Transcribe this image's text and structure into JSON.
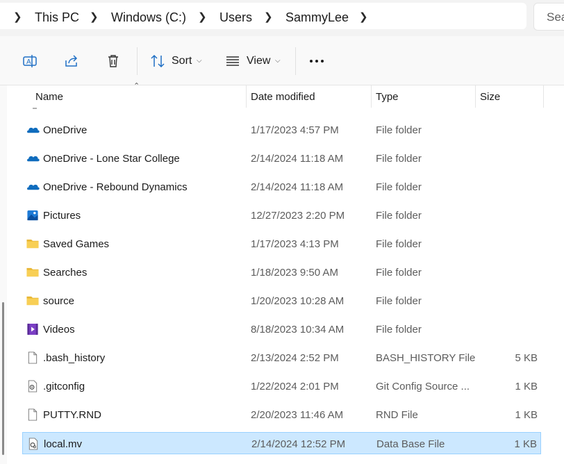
{
  "breadcrumb": {
    "items": [
      "This PC",
      "Windows (C:)",
      "Users",
      "SammyLee"
    ]
  },
  "search": {
    "placeholder": "Sea"
  },
  "toolbar": {
    "sort_label": "Sort",
    "view_label": "View"
  },
  "columns": {
    "name": "Name",
    "date": "Date modified",
    "type": "Type",
    "size": "Size"
  },
  "files": [
    {
      "name": "OneDrive",
      "date": "1/17/2023 4:57 PM",
      "type": "File folder",
      "size": "",
      "icon": "onedrive-icon"
    },
    {
      "name": "OneDrive - Lone Star College",
      "date": "2/14/2024 11:18 AM",
      "type": "File folder",
      "size": "",
      "icon": "onedrive-icon"
    },
    {
      "name": "OneDrive - Rebound Dynamics",
      "date": "2/14/2024 11:18 AM",
      "type": "File folder",
      "size": "",
      "icon": "onedrive-icon"
    },
    {
      "name": "Pictures",
      "date": "12/27/2023 2:20 PM",
      "type": "File folder",
      "size": "",
      "icon": "pictures-icon"
    },
    {
      "name": "Saved Games",
      "date": "1/17/2023 4:13 PM",
      "type": "File folder",
      "size": "",
      "icon": "folder-icon"
    },
    {
      "name": "Searches",
      "date": "1/18/2023 9:50 AM",
      "type": "File folder",
      "size": "",
      "icon": "folder-icon"
    },
    {
      "name": "source",
      "date": "1/20/2023 10:28 AM",
      "type": "File folder",
      "size": "",
      "icon": "folder-icon"
    },
    {
      "name": "Videos",
      "date": "8/18/2023 10:34 AM",
      "type": "File folder",
      "size": "",
      "icon": "videos-icon"
    },
    {
      "name": ".bash_history",
      "date": "2/13/2024 2:52 PM",
      "type": "BASH_HISTORY File",
      "size": "5 KB",
      "icon": "file-icon"
    },
    {
      "name": ".gitconfig",
      "date": "1/22/2024 2:01 PM",
      "type": "Git Config Source ...",
      "size": "1 KB",
      "icon": "config-file-icon"
    },
    {
      "name": "PUTTY.RND",
      "date": "2/20/2023 11:46 AM",
      "type": "RND File",
      "size": "1 KB",
      "icon": "file-icon"
    },
    {
      "name": "local.mv",
      "date": "2/14/2024 12:52 PM",
      "type": "Data Base File",
      "size": "1 KB",
      "icon": "database-file-icon",
      "selected": true
    }
  ]
}
